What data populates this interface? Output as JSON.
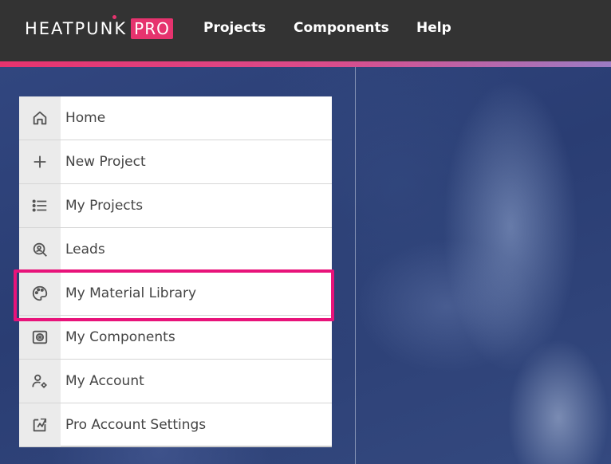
{
  "header": {
    "logo_text": "HEATPUNK",
    "logo_badge": "PRO",
    "nav": [
      {
        "label": "Projects"
      },
      {
        "label": "Components"
      },
      {
        "label": "Help"
      }
    ],
    "accent_color": "#e6336e"
  },
  "menu": {
    "items": [
      {
        "label": "Home",
        "icon": "home-icon"
      },
      {
        "label": "New Project",
        "icon": "plus-icon"
      },
      {
        "label": "My Projects",
        "icon": "list-icon"
      },
      {
        "label": "Leads",
        "icon": "search-user-icon"
      },
      {
        "label": "My Material Library",
        "icon": "palette-icon",
        "highlighted": true
      },
      {
        "label": "My Components",
        "icon": "component-icon"
      },
      {
        "label": "My Account",
        "icon": "user-gear-icon"
      },
      {
        "label": "Pro Account Settings",
        "icon": "settings-doc-icon"
      }
    ],
    "highlight_color": "#e8137a"
  }
}
